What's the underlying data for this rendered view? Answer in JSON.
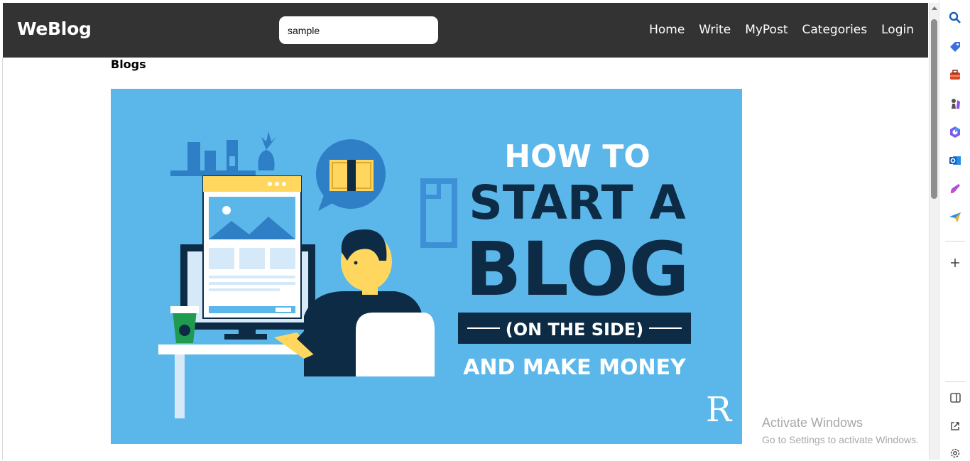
{
  "header": {
    "brand": "WeBlog",
    "search_value": "sample",
    "nav": [
      "Home",
      "Write",
      "MyPost",
      "Categories",
      "Login"
    ]
  },
  "main": {
    "section_title": "Blogs",
    "hero": {
      "line1": "HOW TO",
      "line2": "START A",
      "line3": "BLOG",
      "line4": "(ON THE SIDE)",
      "line5": "AND MAKE MONEY",
      "logo_mark": "R"
    }
  },
  "watermark": {
    "title": "Activate Windows",
    "subtitle": "Go to Settings to activate Windows."
  },
  "sidebar": {
    "icons": [
      "search-icon",
      "tag-icon",
      "briefcase-icon",
      "chess-icon",
      "copilot-icon",
      "outlook-icon",
      "designer-icon",
      "send-icon",
      "add-icon",
      "split-screen-icon",
      "external-link-icon",
      "settings-icon"
    ]
  },
  "colors": {
    "navbar": "#333333",
    "hero_bg": "#5bb7ea",
    "hero_dark": "#0d2b45",
    "accent_yellow": "#ffd75e"
  }
}
